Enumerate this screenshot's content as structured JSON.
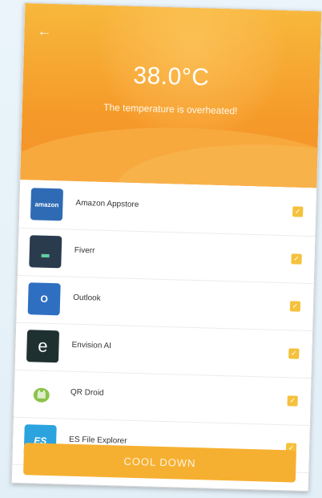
{
  "header": {
    "back_icon": "back-arrow-icon",
    "temperature": "38.0°C",
    "warning": "The temperature is overheated!"
  },
  "apps": [
    {
      "name": "Amazon Appstore",
      "icon": "amazon-icon",
      "icon_text": "amazon",
      "color": "#2f6bb5",
      "checked": true
    },
    {
      "name": "Fiverr",
      "icon": "fiverr-icon",
      "icon_text": "▂",
      "color": "#2a3b4e",
      "checked": true
    },
    {
      "name": "Outlook",
      "icon": "outlook-icon",
      "icon_text": "O",
      "color": "#2f6fc2",
      "checked": true
    },
    {
      "name": "Envision AI",
      "icon": "envision-icon",
      "icon_text": "e",
      "color": "#1f3030",
      "checked": true
    },
    {
      "name": "QR Droid",
      "icon": "qr-droid-icon",
      "icon_text": "",
      "color": "#8bc34a",
      "checked": true
    },
    {
      "name": "ES File Explorer",
      "icon": "es-file-explorer-icon",
      "icon_text": "ES",
      "color": "#2ba3df",
      "checked": true
    }
  ],
  "cool_down_label": "COOL DOWN",
  "colors": {
    "header_top": "#f7b83c",
    "header_bottom": "#f4912a",
    "checkbox": "#f5c13c",
    "button": "#f6b031"
  }
}
